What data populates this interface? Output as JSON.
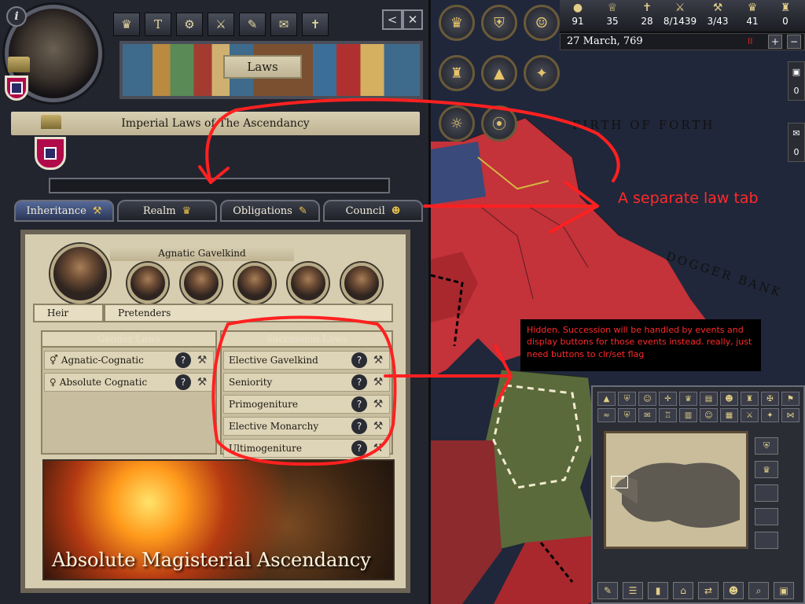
{
  "window": {
    "title": "Laws",
    "realm_title": "Imperial Laws of The Ascendancy"
  },
  "buttons": {
    "info": "i",
    "back": "<",
    "close": "✕"
  },
  "top_icons": [
    "♛",
    "T",
    "⚙",
    "⚔",
    "✎",
    "✉",
    "✝"
  ],
  "tabs": [
    {
      "label": "Inheritance",
      "icon": "hammer-icon",
      "active": true
    },
    {
      "label": "Realm",
      "icon": "crown-icon",
      "active": false
    },
    {
      "label": "Obligations",
      "icon": "scroll-icon",
      "active": false
    },
    {
      "label": "Council",
      "icon": "council-icon",
      "active": false
    }
  ],
  "inheritance": {
    "banner": "Agnatic Gavelkind",
    "heir_tab": "Heir",
    "pretenders_tab": "Pretenders",
    "gender_laws": {
      "header": "Gender Laws",
      "items": [
        {
          "label": "Agnatic-Cognatic",
          "glyph": "⚥"
        },
        {
          "label": "Absolute Cognatic",
          "glyph": "♀"
        }
      ]
    },
    "succession_laws": {
      "header": "Succession Laws",
      "items": [
        "Elective Gavelkind",
        "Seniority",
        "Primogeniture",
        "Elective Monarchy",
        "Ultimogeniture"
      ]
    },
    "help_glyph": "?",
    "law_hammer": "⚒",
    "art_title": "Absolute Magisterial Ascendancy"
  },
  "resources": [
    {
      "icon": "gold-icon",
      "glyph": "●",
      "value": "91"
    },
    {
      "icon": "prestige-icon",
      "glyph": "♕",
      "value": "35"
    },
    {
      "icon": "piety-icon",
      "glyph": "✝",
      "value": "28"
    },
    {
      "icon": "levy-icon",
      "glyph": "⚔",
      "value": "8/1439"
    },
    {
      "icon": "demesne-icon",
      "glyph": "⚒",
      "value": "3/43"
    },
    {
      "icon": "vassal-icon",
      "glyph": "♛",
      "value": "41"
    },
    {
      "icon": "vassal-limit-icon",
      "glyph": "♜",
      "value": "0"
    }
  ],
  "date": {
    "text": "27 March, 769",
    "pause": "II",
    "plus": "+",
    "minus": "−"
  },
  "side_chips": [
    {
      "glyph": "▣",
      "value": "0"
    },
    {
      "glyph": "✉",
      "value": "0"
    }
  ],
  "map_labels": [
    "FIRTH OF FORTH",
    "DOGGER BANK"
  ],
  "annotations": {
    "separate_tab": "A separate law tab",
    "hidden_note": "Hidden. Succession will be handled by events and display buttons for those events instead. really, just need buttons to clr/set flag"
  },
  "colors": {
    "annotation": "#ff2a2a",
    "tab_active": "#3b4a74",
    "parchment": "#d6ccaf"
  }
}
